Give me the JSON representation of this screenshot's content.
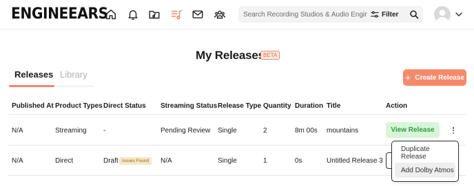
{
  "app": {
    "logo": "ENGINEEARS"
  },
  "search": {
    "placeholder": "Search Recording Studios & Audio Engine...",
    "filter_label": "Filter"
  },
  "nav": {
    "icons": [
      "home-icon",
      "bell-icon",
      "folder-music-icon",
      "playlist-icon",
      "mail-icon",
      "community-icon"
    ]
  },
  "page": {
    "title": "My Releases",
    "badge": "BETA"
  },
  "tabs": [
    {
      "label": "Releases",
      "active": true
    },
    {
      "label": "Library",
      "active": false
    }
  ],
  "create_button": {
    "label": "Create Release",
    "icon": "+"
  },
  "table": {
    "headers": [
      "Published At",
      "Product Types",
      "Direct Status",
      "Streaming Status",
      "Release Type",
      "Quantity",
      "Duration",
      "Title",
      "Action"
    ],
    "rows": [
      {
        "published_at": "N/A",
        "product_type": "Streaming",
        "direct_status": "-",
        "direct_badge": "",
        "streaming_status": "Pending Review",
        "release_type": "Single",
        "quantity": "2",
        "duration": "8m 00s",
        "title": "mountains",
        "action": "View Release"
      },
      {
        "published_at": "N/A",
        "product_type": "Direct",
        "direct_status": "Draft",
        "direct_badge": "Issues Found",
        "streaming_status": "N/A",
        "release_type": "Single",
        "quantity": "1",
        "duration": "0s",
        "title": "Untitled Release 3",
        "action": ""
      }
    ]
  },
  "menu": {
    "items": [
      "Duplicate Release",
      "Add Dolby Atmos"
    ]
  },
  "colors": {
    "accent": "#f58a6b",
    "success_bg": "#d9f5d9",
    "success_text": "#2e9d3a",
    "badge_bg": "#f8e7c4"
  }
}
